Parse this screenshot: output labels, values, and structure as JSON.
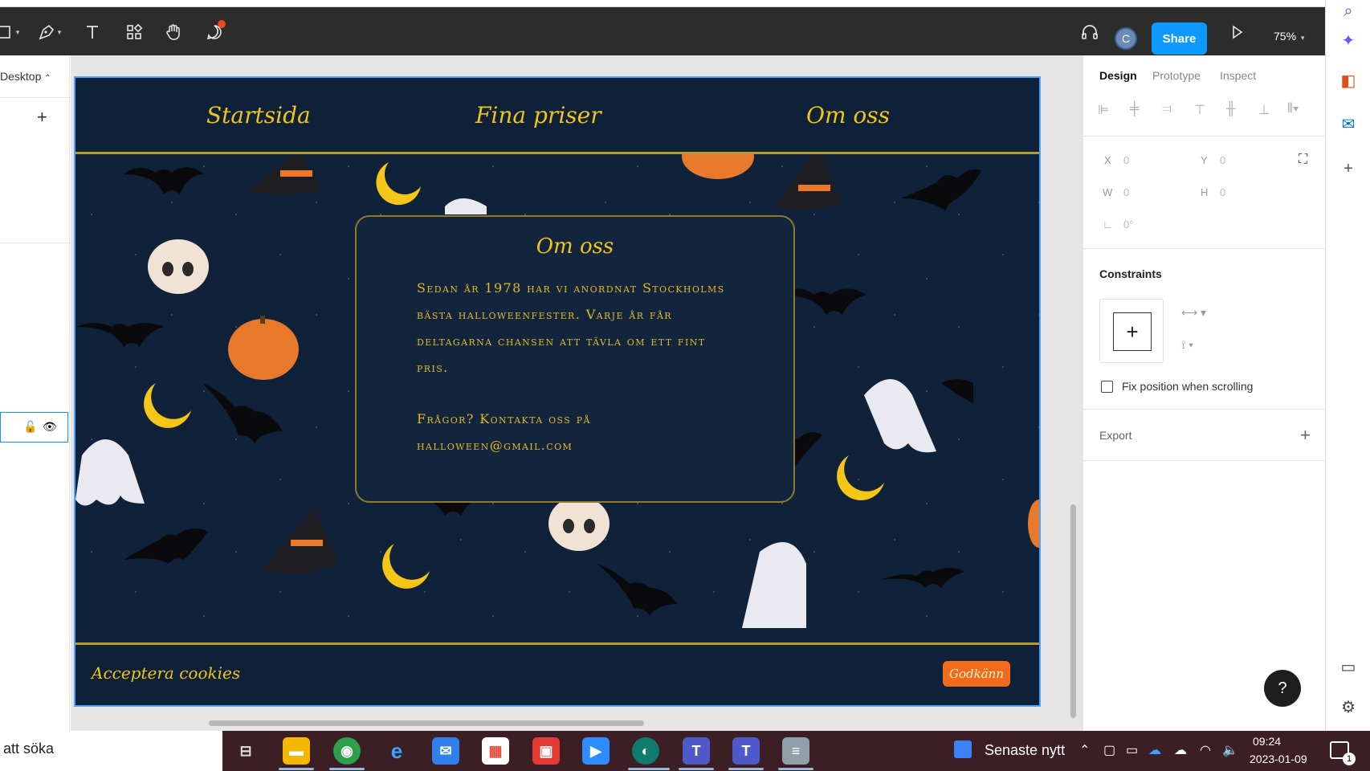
{
  "toolbar": {
    "avatar_initial": "C",
    "share_label": "Share",
    "zoom_label": "75%"
  },
  "left_panel": {
    "page_label": "Desktop"
  },
  "site": {
    "nav": [
      "Startsida",
      "Fina priser",
      "Om oss"
    ],
    "card_title": "Om oss",
    "card_text": "Sedan år 1978 har vi anordnat Stockholms bästa halloweenfester. Varje år får deltagarna chansen att tävla om ett fint pris.",
    "card_contact": "Frågor? Kontakta oss på halloween@gmail.com",
    "cookie_text": "Acceptera cookies",
    "cookie_button": "Godkänn"
  },
  "right_panel": {
    "tabs": [
      "Design",
      "Prototype",
      "Inspect"
    ],
    "fields": {
      "x_label": "X",
      "x_value": "0",
      "y_label": "Y",
      "y_value": "0",
      "w_label": "W",
      "w_value": "0",
      "h_label": "H",
      "h_value": "0",
      "rot_value": "0°"
    },
    "constraints_title": "Constraints",
    "fix_position_label": "Fix position when scrolling",
    "export_label": "Export",
    "help_label": "?"
  },
  "taskbar": {
    "search_text": "att söka",
    "news_label": "Senaste nytt",
    "time": "09:24",
    "date": "2023-01-09",
    "notification_count": "1"
  },
  "colors": {
    "accent": "#0d99ff",
    "site_bg": "#10213a",
    "site_gold": "#f0c419",
    "cookie_button": "#f26a1b",
    "taskbar": "#3b1f24"
  }
}
